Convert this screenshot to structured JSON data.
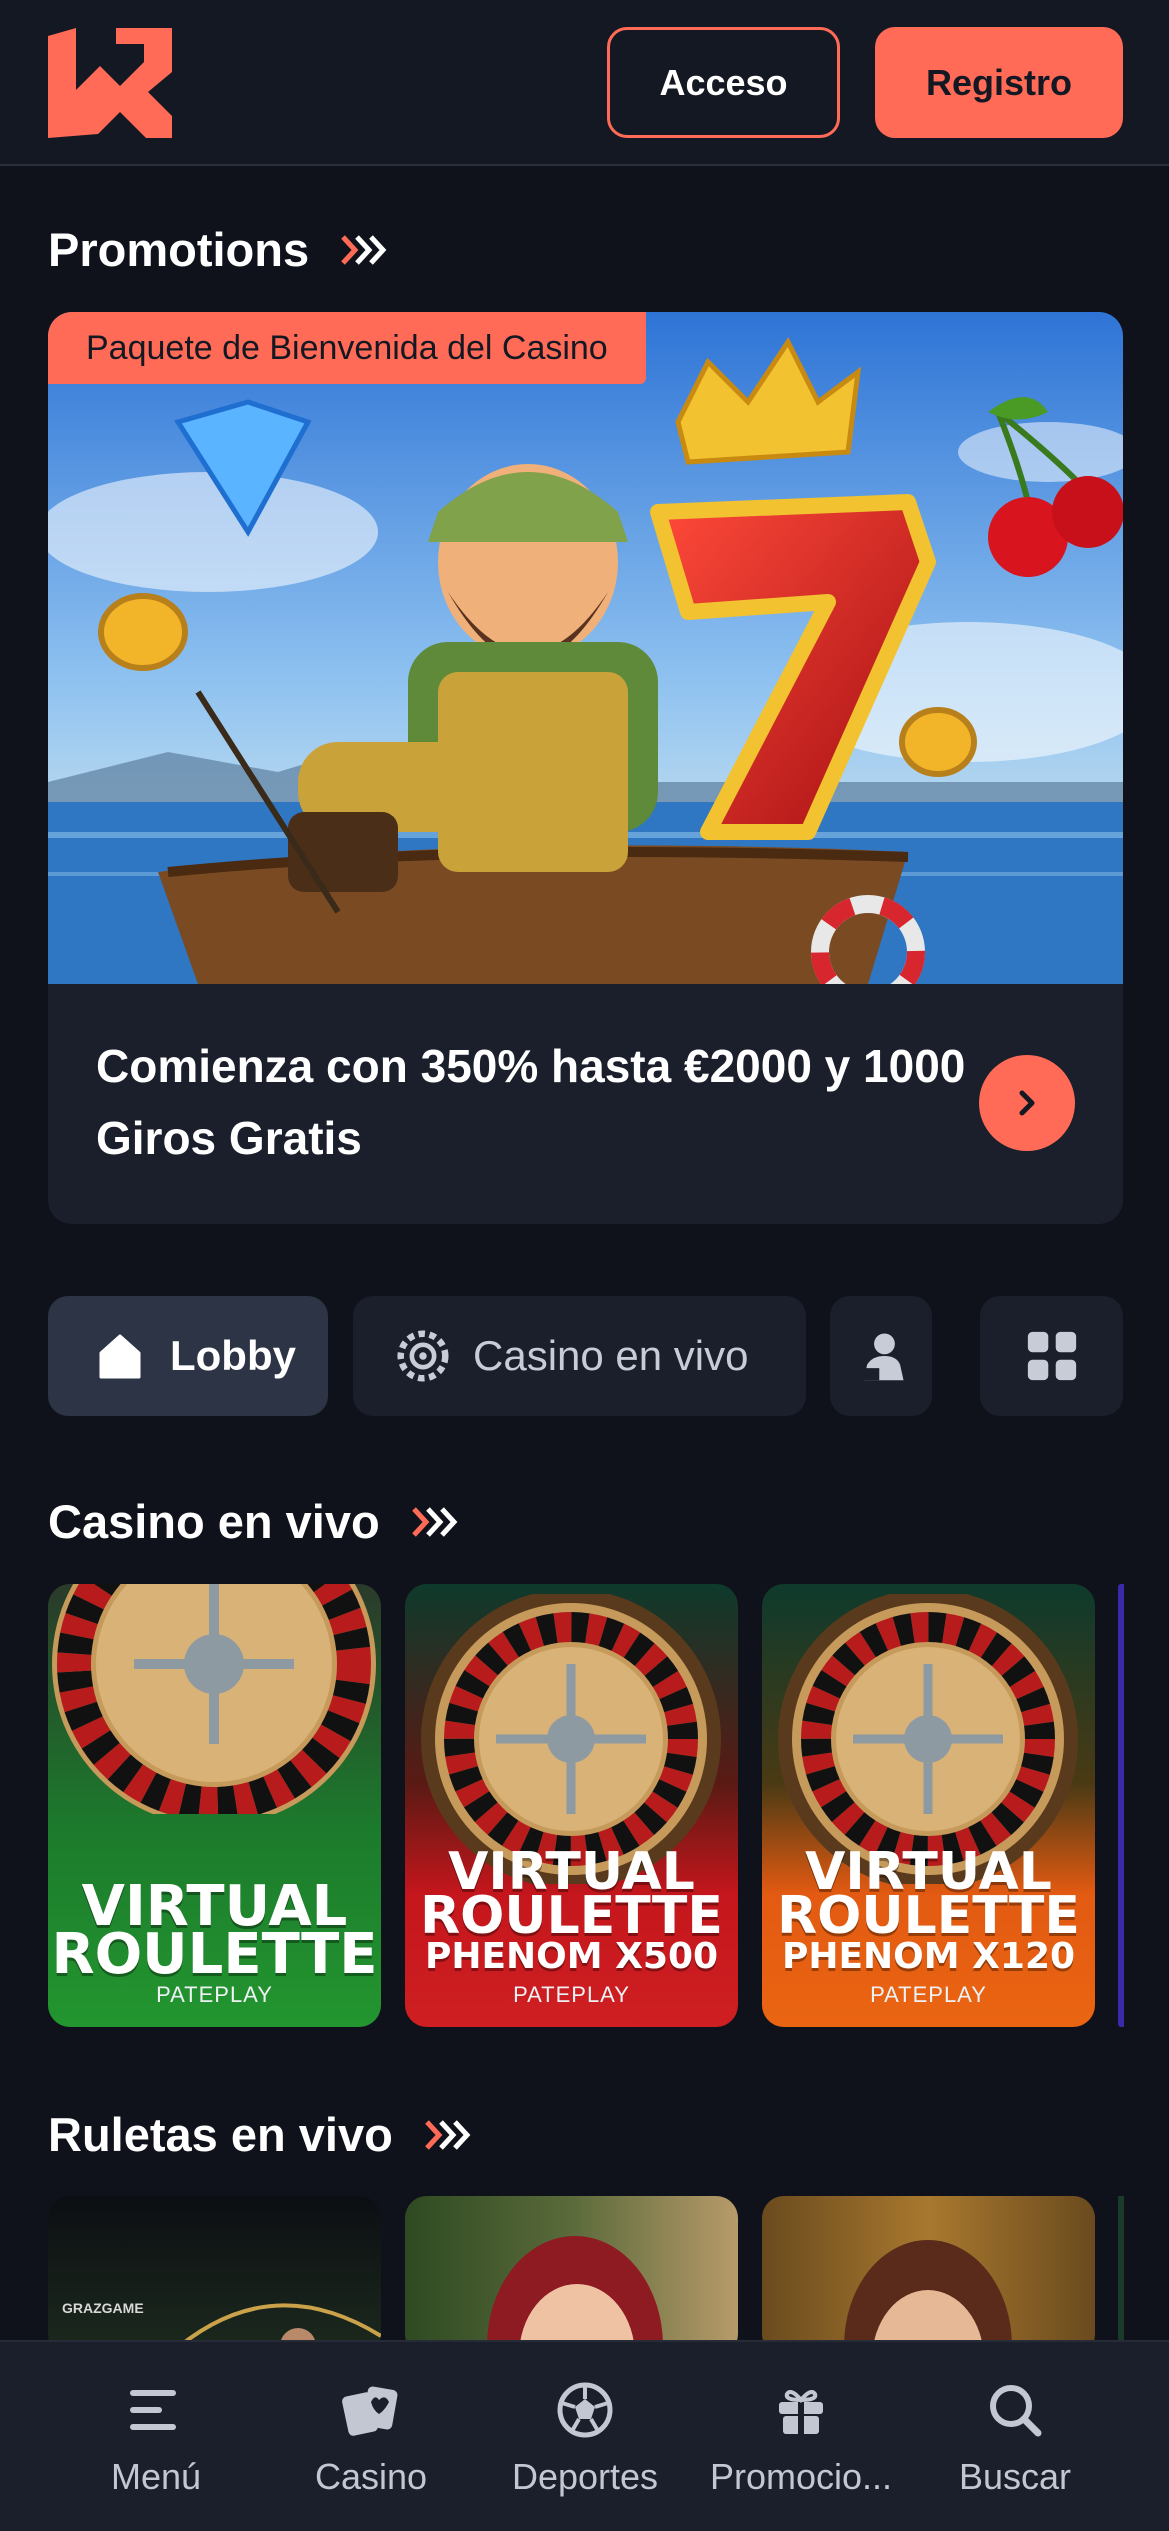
{
  "header": {
    "login_label": "Acceso",
    "register_label": "Registro",
    "accent": "#ff6b57"
  },
  "promotions": {
    "title": "Promotions",
    "card": {
      "tag": "Paquete de Bienvenida del Casino",
      "text": "Comienza con 350% hasta €2000 y 1000 Giros Gratis"
    }
  },
  "tabs": [
    {
      "label": "Lobby",
      "icon": "home-icon",
      "active": true
    },
    {
      "label": "Casino en vivo",
      "icon": "roulette-wheel-icon",
      "active": false
    },
    {
      "label": "",
      "icon": "dealer-icon",
      "active": false
    },
    {
      "label": "",
      "icon": "grid-icon",
      "active": false
    }
  ],
  "live_casino": {
    "title": "Casino en vivo",
    "games": [
      {
        "line1": "VIRTUAL",
        "line2": "ROULETTE",
        "line3": "",
        "provider": "PATEPLAY",
        "color": "#1f8a2e"
      },
      {
        "line1": "VIRTUAL",
        "line2": "ROULETTE",
        "line3": "PHENOM X500",
        "provider": "PATEPLAY",
        "color": "#c4161c"
      },
      {
        "line1": "VIRTUAL",
        "line2": "ROULETTE",
        "line3": "PHENOM X120",
        "provider": "PATEPLAY",
        "color": "#e35a12"
      }
    ]
  },
  "live_roulettes": {
    "title": "Ruletas en vivo",
    "games": [
      {
        "provider_label": "GRAZGAME"
      },
      {
        "provider_label": ""
      },
      {
        "provider_label": ""
      }
    ]
  },
  "bottom_nav": [
    {
      "label": "Menú",
      "icon": "menu-icon"
    },
    {
      "label": "Casino",
      "icon": "cards-icon"
    },
    {
      "label": "Deportes",
      "icon": "soccer-ball-icon"
    },
    {
      "label": "Promocio...",
      "icon": "gift-icon"
    },
    {
      "label": "Buscar",
      "icon": "search-icon"
    }
  ]
}
